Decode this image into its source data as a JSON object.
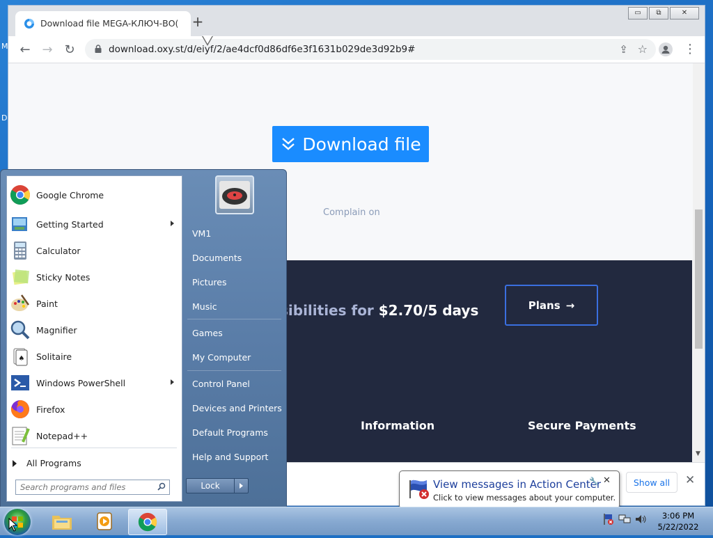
{
  "desktop": {
    "glyph_top": "M",
    "glyph_mid": "D"
  },
  "browser": {
    "tab_title": "Download file MEGA-КЛЮЧ-ВО(",
    "url": "download.oxy.st/d/eiyf/2/ae4dcf0d86df6e3f1631b029de3d92b9#",
    "window_buttons": {
      "minimize": "▭",
      "restore": "⧉",
      "close": "✕"
    },
    "page": {
      "download_label": "Download file",
      "complain_text": "Complain on",
      "promo_muted": "sibilities for",
      "promo_price": "$2.70/5 days",
      "plans_label": "Plans",
      "info_title": "Information",
      "secure_title": "Secure Payments"
    },
    "download_bar": {
      "show_all": "Show all"
    }
  },
  "start_menu": {
    "programs": [
      {
        "label": "Google Chrome",
        "icon": "chrome-icon",
        "submenu": false
      },
      {
        "label": "Getting Started",
        "icon": "getting-started-icon",
        "submenu": true
      },
      {
        "label": "Calculator",
        "icon": "calculator-icon",
        "submenu": false
      },
      {
        "label": "Sticky Notes",
        "icon": "sticky-notes-icon",
        "submenu": false
      },
      {
        "label": "Paint",
        "icon": "paint-icon",
        "submenu": false
      },
      {
        "label": "Magnifier",
        "icon": "magnifier-icon",
        "submenu": false
      },
      {
        "label": "Solitaire",
        "icon": "solitaire-icon",
        "submenu": false
      },
      {
        "label": "Windows PowerShell",
        "icon": "powershell-icon",
        "submenu": true
      },
      {
        "label": "Firefox",
        "icon": "firefox-icon",
        "submenu": false
      },
      {
        "label": "Notepad++",
        "icon": "notepadpp-icon",
        "submenu": false
      }
    ],
    "all_programs": "All Programs",
    "search_placeholder": "Search programs and files",
    "right": {
      "user": "VM1",
      "documents": "Documents",
      "pictures": "Pictures",
      "music": "Music",
      "games": "Games",
      "my_computer": "My Computer",
      "control_panel": "Control Panel",
      "devices_printers": "Devices and Printers",
      "default_programs": "Default Programs",
      "help_support": "Help and Support"
    },
    "lock_label": "Lock"
  },
  "balloon": {
    "title": "View messages in Action Center",
    "message": "Click to view messages about your computer."
  },
  "taskbar": {
    "time": "3:06 PM",
    "date": "5/22/2022"
  },
  "colors": {
    "download_blue": "#1a8cff",
    "dark_band": "#22293f",
    "plans_border": "#3a6fe0"
  }
}
